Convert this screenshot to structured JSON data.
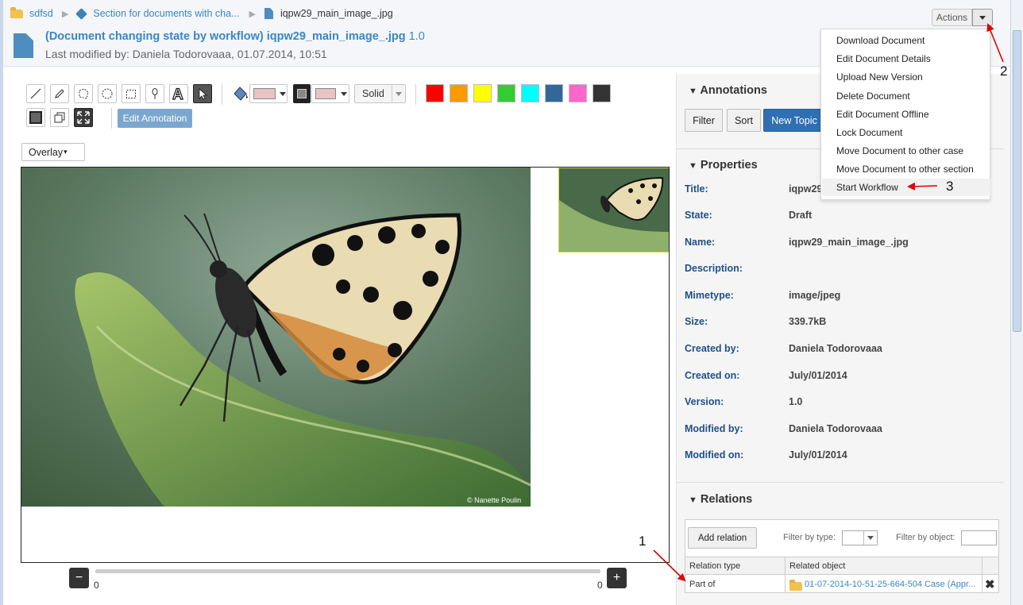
{
  "breadcrumb": {
    "folder": "sdfsd",
    "section": "Section for documents with cha...",
    "document": "iqpw29_main_image_.jpg"
  },
  "header": {
    "title": "(Document changing state by workflow) iqpw29_main_image_.jpg",
    "version": "1.0",
    "subtitle": "Last modified by: Daniela Todorovaaa, 01.07.2014, 10:51"
  },
  "actions": {
    "label": "Actions",
    "menu": [
      "Download Document",
      "Edit Document Details",
      "Upload New Version",
      "Delete Document",
      "Edit Document Offline",
      "Lock Document",
      "Move Document to other case",
      "Move Document to other section",
      "Start Workflow"
    ]
  },
  "toolbar": {
    "line_style": "Solid",
    "edit_annotation": "Edit Annotation",
    "overlay": "Overlay",
    "colors": [
      "#ff0000",
      "#ff9900",
      "#ffff00",
      "#33cc33",
      "#00ffff",
      "#336699",
      "#ff66cc",
      "#333333"
    ],
    "fill_color": "#e8c4c4",
    "stroke_color": "#e8c4c4"
  },
  "image": {
    "credit": "© Nanette Poulin"
  },
  "slider": {
    "min_label": "0",
    "max_label": "0",
    "minus": "−",
    "plus": "+"
  },
  "annotations": {
    "title": "Annotations",
    "filter": "Filter",
    "sort": "Sort",
    "new_topic": "New Topic"
  },
  "properties": {
    "title": "Properties",
    "rows": [
      {
        "label": "Title:",
        "value": "iqpw29_main_image_.jpg"
      },
      {
        "label": "State:",
        "value": "Draft"
      },
      {
        "label": "Name:",
        "value": "iqpw29_main_image_.jpg"
      },
      {
        "label": "Description:",
        "value": ""
      },
      {
        "label": "Mimetype:",
        "value": "image/jpeg"
      },
      {
        "label": "Size:",
        "value": "339.7kB"
      },
      {
        "label": "Created by:",
        "value": "Daniela Todorovaaa"
      },
      {
        "label": "Created on:",
        "value": "July/01/2014"
      },
      {
        "label": "Version:",
        "value": "1.0"
      },
      {
        "label": "Modified by:",
        "value": "Daniela Todorovaaa"
      },
      {
        "label": "Modified on:",
        "value": "July/01/2014"
      }
    ]
  },
  "relations": {
    "title": "Relations",
    "add_relation": "Add relation",
    "filter_type": "Filter by type:",
    "filter_object": "Filter by object:",
    "col_type": "Relation type",
    "col_object": "Related object",
    "row": {
      "type": "Part of",
      "object": "01-07-2014-10-51-25-664-504 Case (Appr..."
    }
  },
  "callouts": [
    "1",
    "2",
    "3"
  ]
}
